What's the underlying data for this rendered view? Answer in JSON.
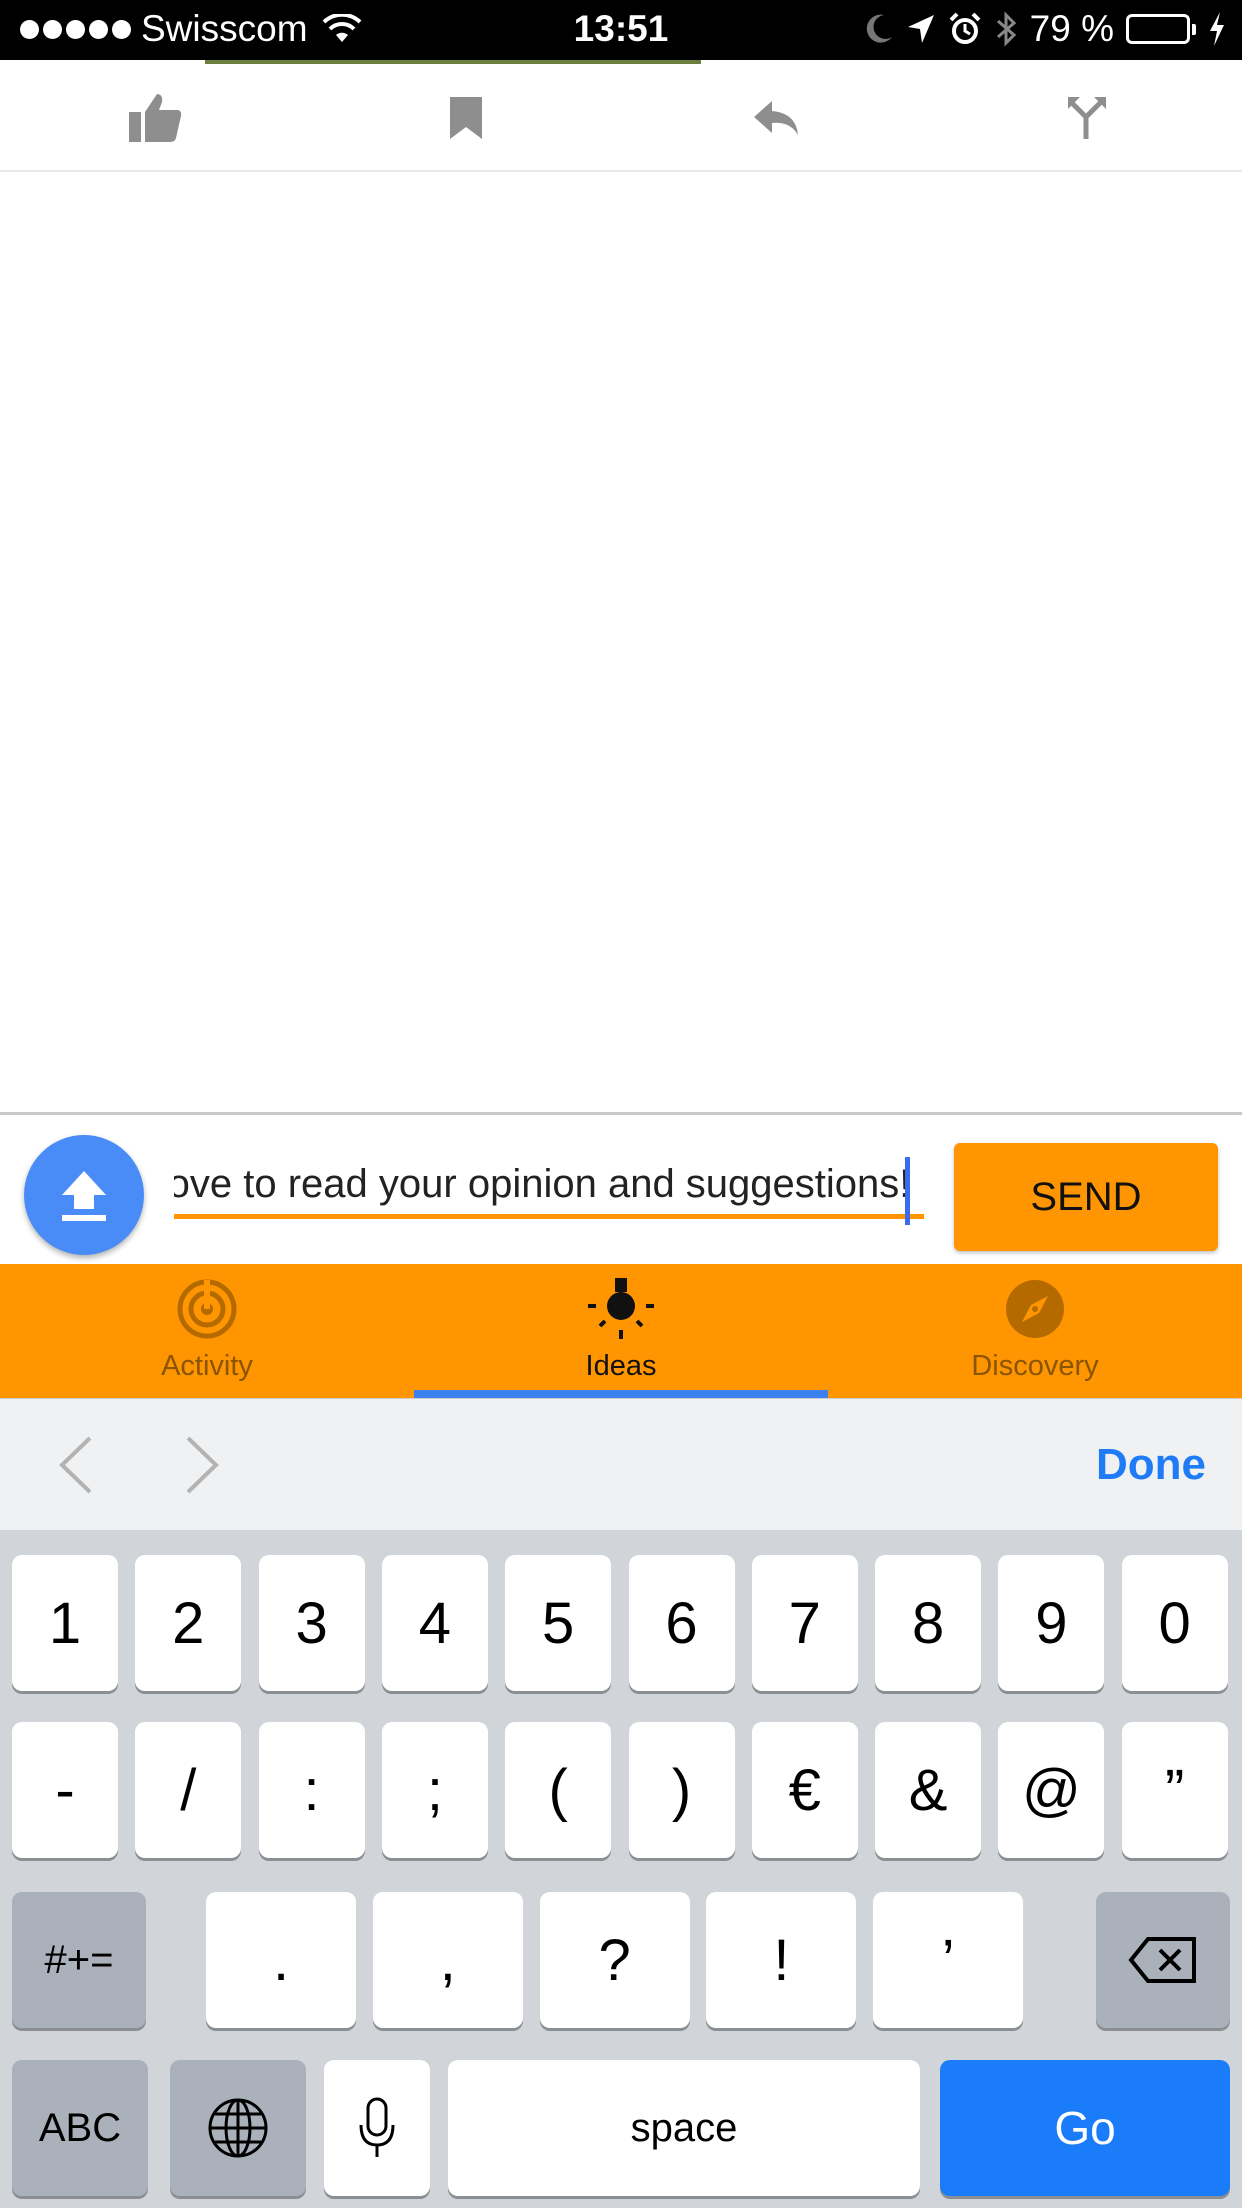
{
  "status_bar": {
    "carrier": "Swisscom",
    "time": "13:51",
    "battery_percent": "79 %",
    "battery_level": 0.79
  },
  "action_bar": {
    "icons": [
      "thumbs-up-icon",
      "bookmark-icon",
      "reply-icon",
      "split-icon"
    ]
  },
  "compose": {
    "input_value": "Let us know what you think. We'd love to read your opinion and suggestions!",
    "visible_text": "l to read your opinion and suggestions!",
    "send_label": "SEND"
  },
  "tabs": [
    {
      "label": "Activity",
      "icon": "target-icon",
      "active": false
    },
    {
      "label": "Ideas",
      "icon": "lightbulb-icon",
      "active": true
    },
    {
      "label": "Discovery",
      "icon": "compass-icon",
      "active": false
    }
  ],
  "accessory": {
    "done_label": "Done"
  },
  "keyboard": {
    "row1": [
      "1",
      "2",
      "3",
      "4",
      "5",
      "6",
      "7",
      "8",
      "9",
      "0"
    ],
    "row2": [
      "-",
      "/",
      ":",
      ";",
      "(",
      ")",
      "€",
      "&",
      "@",
      "”"
    ],
    "row3": [
      ".",
      ",",
      "?",
      "!",
      "’"
    ],
    "symbols_label": "#+=",
    "abc_label": "ABC",
    "space_label": "space",
    "go_label": "Go"
  },
  "colors": {
    "accent": "#ff9500",
    "tab_indicator": "#3b82f0",
    "upload_button": "#4a8cf7",
    "done_link": "#1f7cf6",
    "go_key": "#1a7cf9"
  }
}
